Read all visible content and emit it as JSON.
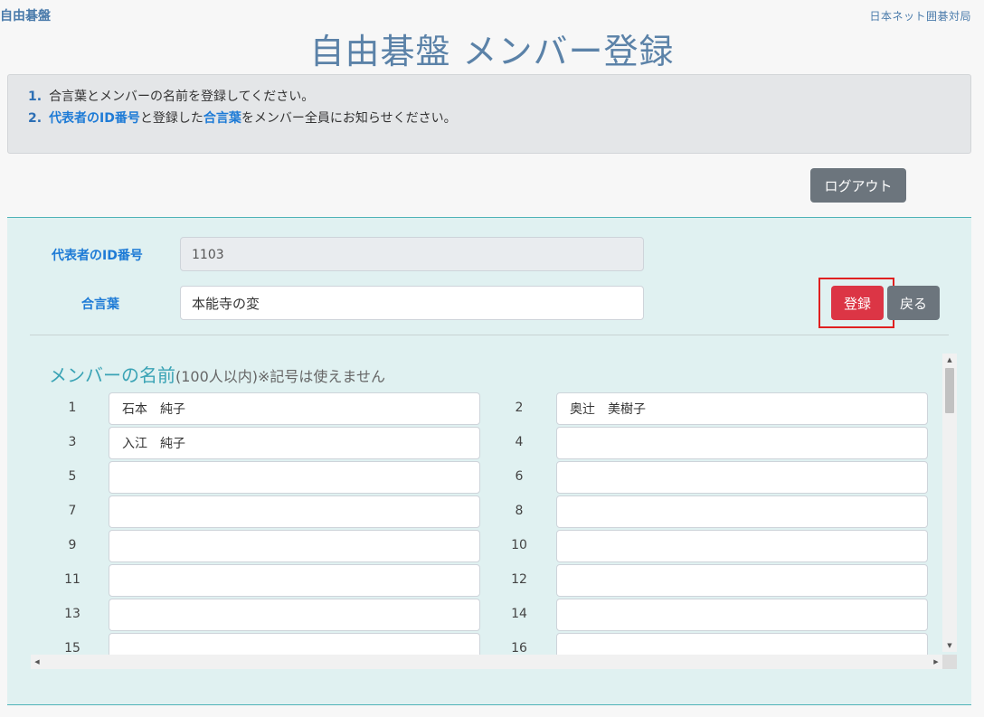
{
  "header": {
    "logo": "自由碁盤",
    "org_link": "日本ネット囲碁対局",
    "title": "自由碁盤 メンバー登録"
  },
  "instructions": {
    "step1_num": "1.",
    "step1_text": "合言葉とメンバーの名前を登録してください。",
    "step2_num": "2.",
    "step2_hl1": "代表者のID番号",
    "step2_mid": "と登録した",
    "step2_hl2": "合言葉",
    "step2_tail": "をメンバー全員にお知らせください。"
  },
  "logout_label": "ログアウト",
  "form": {
    "id_label": "代表者のID番号",
    "id_value": "1103",
    "password_label": "合言葉",
    "password_value": "本能寺の変",
    "register_label": "登録",
    "back_label": "戻る"
  },
  "members": {
    "title": "メンバーの名前",
    "subtitle": "(100人以内)※記号は使えません",
    "rows": [
      {
        "n": "1",
        "name": "石本　純子"
      },
      {
        "n": "2",
        "name": "奥辻　美樹子"
      },
      {
        "n": "3",
        "name": "入江　純子"
      },
      {
        "n": "4",
        "name": ""
      },
      {
        "n": "5",
        "name": ""
      },
      {
        "n": "6",
        "name": ""
      },
      {
        "n": "7",
        "name": ""
      },
      {
        "n": "8",
        "name": ""
      },
      {
        "n": "9",
        "name": ""
      },
      {
        "n": "10",
        "name": ""
      },
      {
        "n": "11",
        "name": ""
      },
      {
        "n": "12",
        "name": ""
      },
      {
        "n": "13",
        "name": ""
      },
      {
        "n": "14",
        "name": ""
      },
      {
        "n": "15",
        "name": ""
      },
      {
        "n": "16",
        "name": ""
      }
    ]
  },
  "colors": {
    "accent": "#1e7bd6",
    "title": "#5b82a8",
    "panel_bg": "#e0f1f1",
    "danger": "#dc3545",
    "secondary": "#6c757d"
  }
}
